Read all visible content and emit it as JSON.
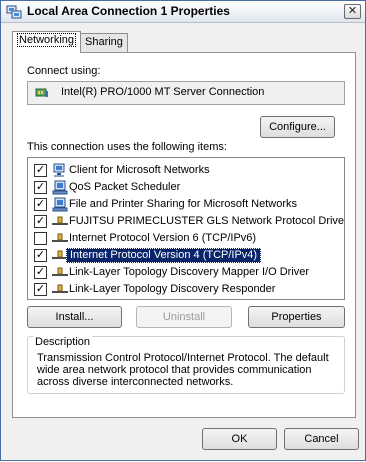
{
  "window": {
    "title": "Local Area Connection 1 Properties",
    "close_symbol": "✕"
  },
  "tabs": [
    {
      "label": "Networking",
      "active": true
    },
    {
      "label": "Sharing",
      "active": false
    }
  ],
  "connect_using": {
    "label": "Connect using:",
    "adapter": "Intel(R) PRO/1000 MT Server Connection",
    "adapter_icon": "network-adapter-icon"
  },
  "configure_button": "Configure...",
  "items_label": "This connection uses the following items:",
  "items": [
    {
      "label": "Client for Microsoft Networks",
      "checked": true,
      "icon": "network-client-icon",
      "selected": false
    },
    {
      "label": "QoS Packet Scheduler",
      "checked": true,
      "icon": "service-icon",
      "selected": false
    },
    {
      "label": "File and Printer Sharing for Microsoft Networks",
      "checked": true,
      "icon": "service-icon",
      "selected": false
    },
    {
      "label": "FUJITSU PRIMECLUSTER GLS Network Protocol Driver",
      "checked": true,
      "icon": "protocol-icon",
      "selected": false
    },
    {
      "label": "Internet Protocol Version 6 (TCP/IPv6)",
      "checked": false,
      "icon": "protocol-icon",
      "selected": false
    },
    {
      "label": "Internet Protocol Version 4 (TCP/IPv4)",
      "checked": true,
      "icon": "protocol-icon",
      "selected": true
    },
    {
      "label": "Link-Layer Topology Discovery Mapper I/O Driver",
      "checked": true,
      "icon": "protocol-icon",
      "selected": false
    },
    {
      "label": "Link-Layer Topology Discovery Responder",
      "checked": true,
      "icon": "protocol-icon",
      "selected": false
    }
  ],
  "check_mark": "✓",
  "buttons": {
    "install": "Install...",
    "uninstall": "Uninstall",
    "properties": "Properties",
    "ok": "OK",
    "cancel": "Cancel"
  },
  "description": {
    "legend": "Description",
    "text": "Transmission Control Protocol/Internet Protocol. The default wide area network protocol that provides communication across diverse interconnected networks."
  },
  "colors": {
    "selection": "#0a246a",
    "window_border": "#4a6da6",
    "dialog_background": "#f0f0f0"
  }
}
